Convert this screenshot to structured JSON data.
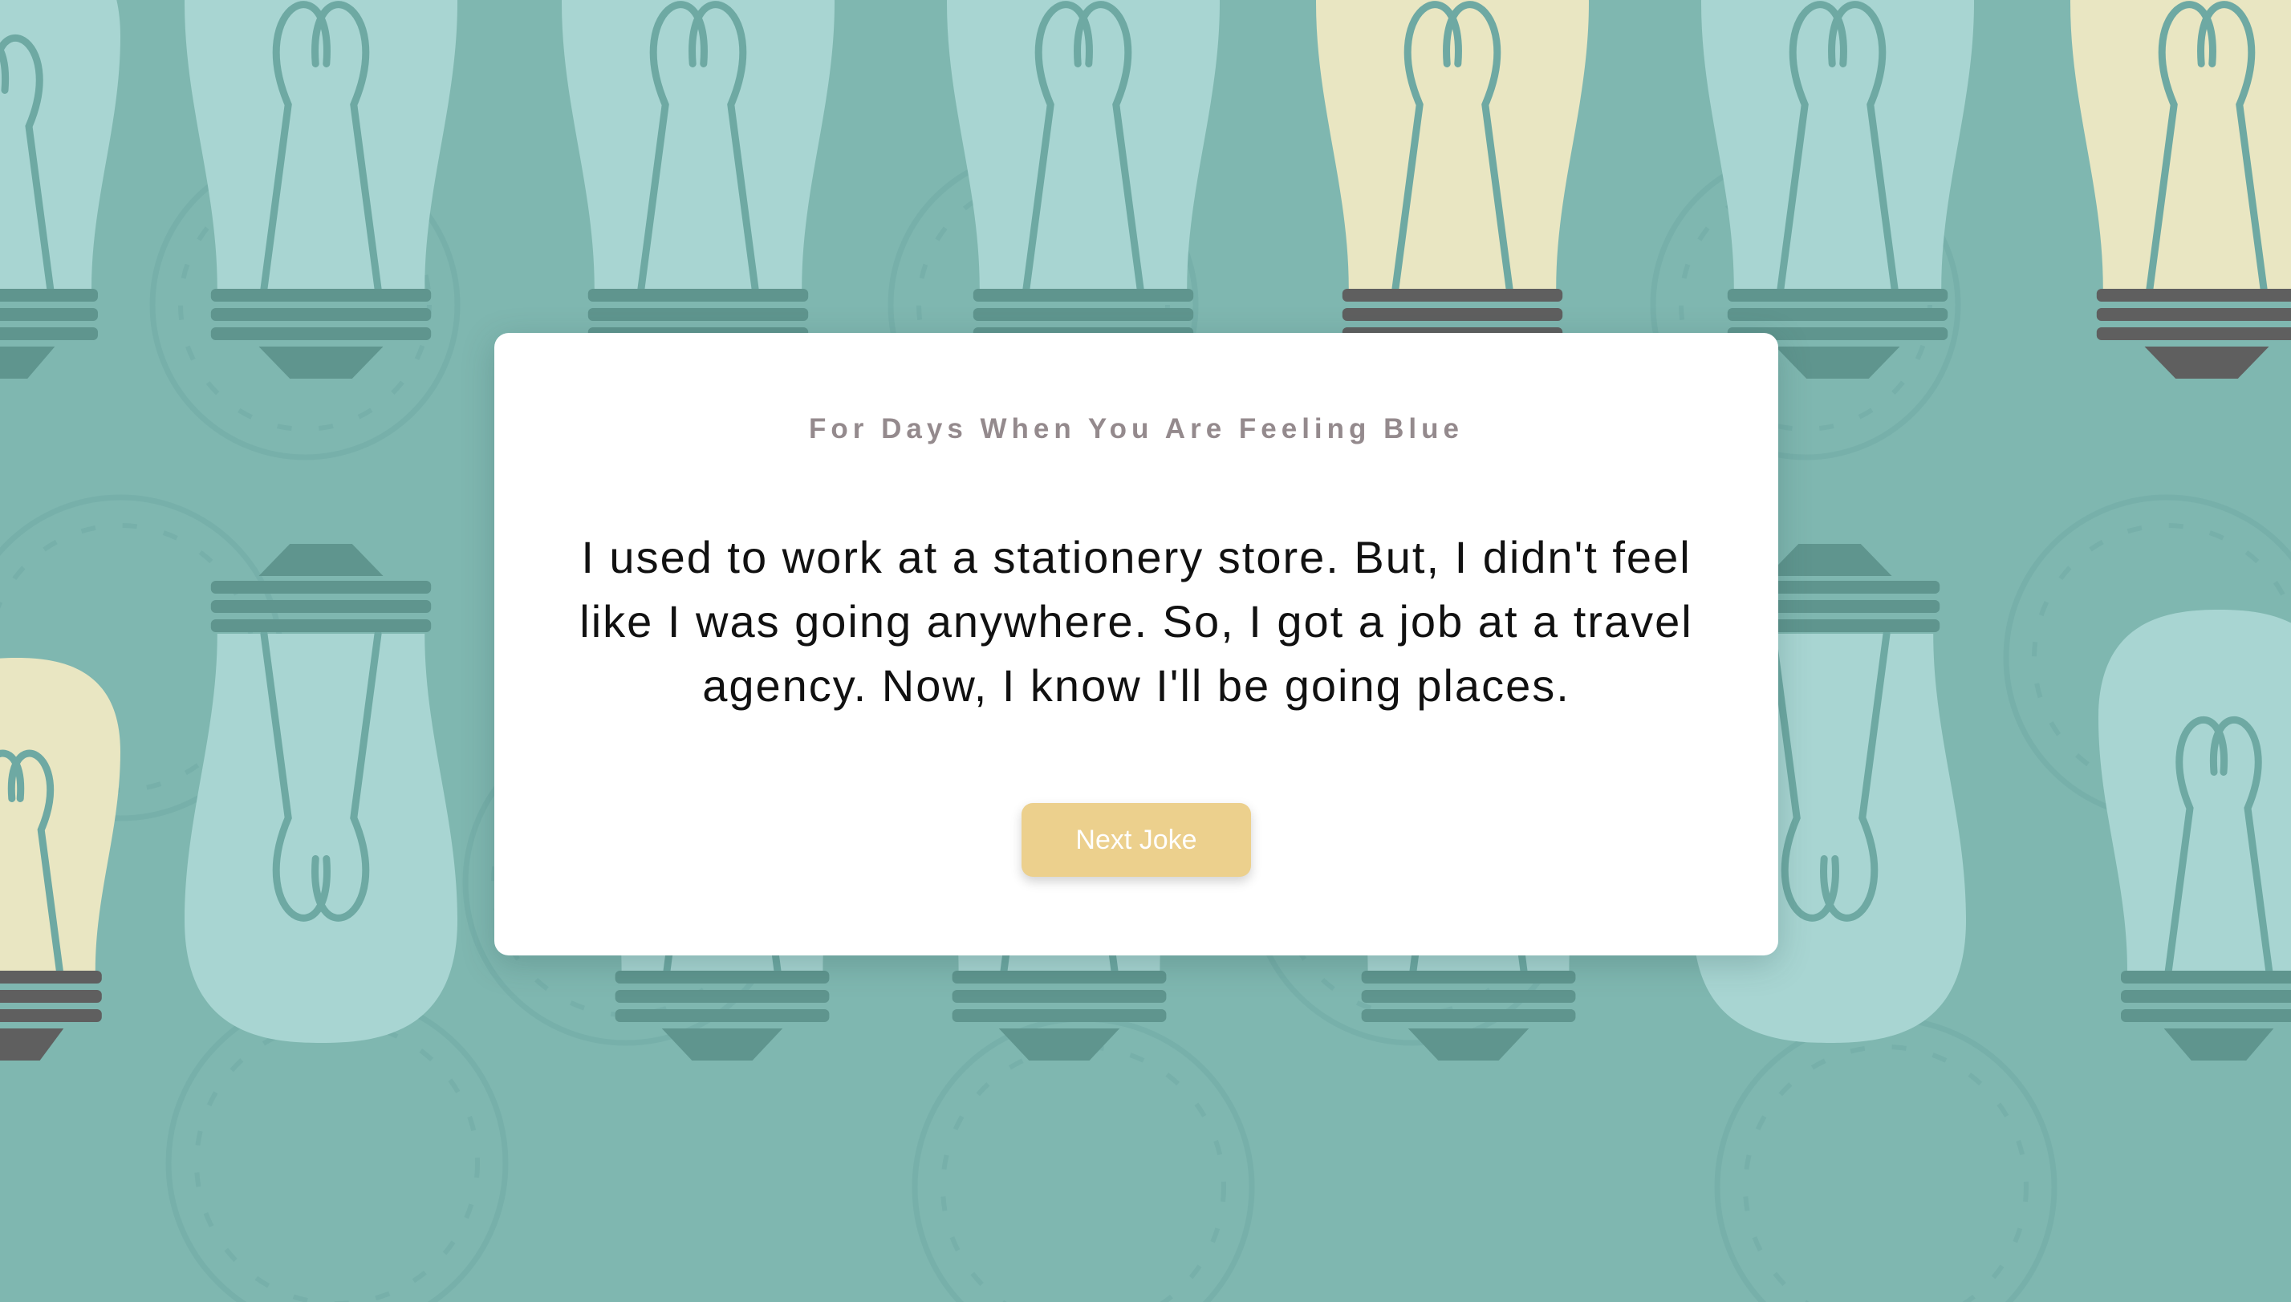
{
  "card": {
    "subtitle": "For Days When You Are Feeling Blue",
    "joke": "I used to work at a stationery store. But, I didn't feel like I was going anywhere. So, I got a job at a travel agency. Now, I know I'll be going places.",
    "button_label": "Next Joke"
  },
  "colors": {
    "background": "#7fb7b0",
    "bulb_blue": "#a8d5d2",
    "bulb_yellow": "#e9e6c2",
    "line": "#6ea9a3",
    "base_teal": "#5f958e",
    "base_dark": "#5f5f5f",
    "button": "#ecd08d",
    "subtitle": "#948a8d"
  },
  "background_pattern": {
    "icon": "lightbulb-icon"
  }
}
